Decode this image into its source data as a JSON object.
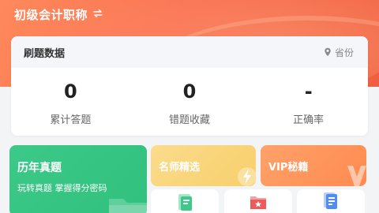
{
  "header": {
    "title": "初级会计职称"
  },
  "stats": {
    "title": "刷题数据",
    "region": "省份",
    "items": [
      {
        "value": "0",
        "label": "累计答题"
      },
      {
        "value": "0",
        "label": "错题收藏"
      },
      {
        "value": "-",
        "label": "正确率"
      }
    ]
  },
  "tiles": {
    "past_exams": {
      "title": "历年真题",
      "subtitle": "玩转真题 掌握得分密码"
    },
    "teacher_pick": {
      "title": "名师精选"
    },
    "vip": {
      "title": "VIP秘籍"
    }
  },
  "colors": {
    "hero": "#fa6e4f",
    "green": "#33c27f",
    "yellow": "#f8d376",
    "orange": "#ff9258"
  },
  "icons": [
    "swap-icon",
    "location-pin-icon",
    "folder-icon",
    "lightning-icon",
    "v-badge-icon",
    "notebook-icon",
    "bookmark-folder-icon",
    "document-icon"
  ]
}
